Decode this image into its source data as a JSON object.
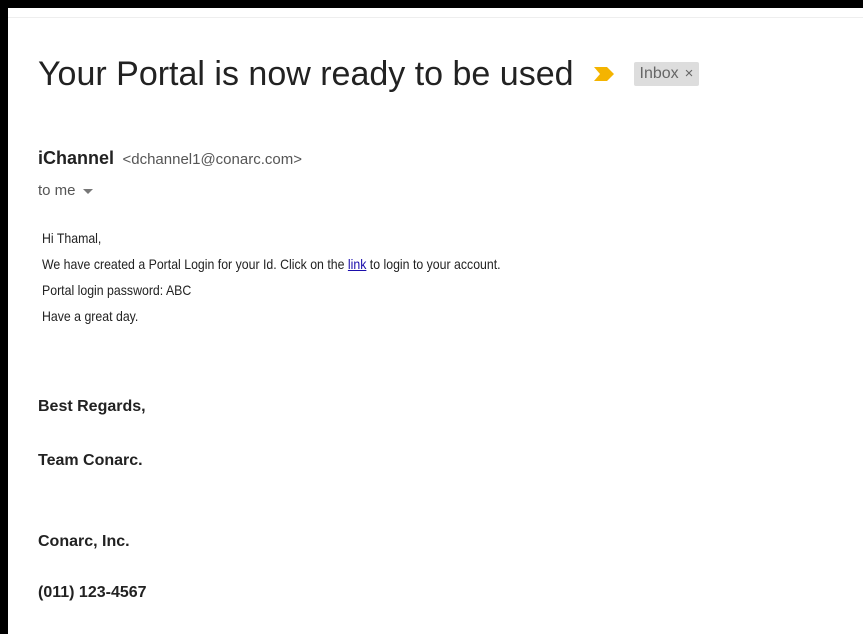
{
  "email": {
    "subject": "Your Portal is now ready to be used",
    "label": {
      "text": "Inbox",
      "remove_glyph": "×"
    },
    "importance_color": "#f4b400",
    "sender": {
      "name": "iChannel",
      "email": "<dchannel1@conarc.com>"
    },
    "recipient": "to me",
    "body": {
      "greeting": "Hi Thamal,",
      "line1_before": "We have created a Portal Login for your Id. Click on the ",
      "link_text": "link",
      "line1_after": " to login to your account.",
      "line2": "Portal login password: ABC",
      "line3": "Have a great day."
    },
    "signature": {
      "regards": "Best Regards,",
      "team": "Team Conarc.",
      "company": "Conarc, Inc.",
      "phone": "(011) 123-4567"
    }
  }
}
